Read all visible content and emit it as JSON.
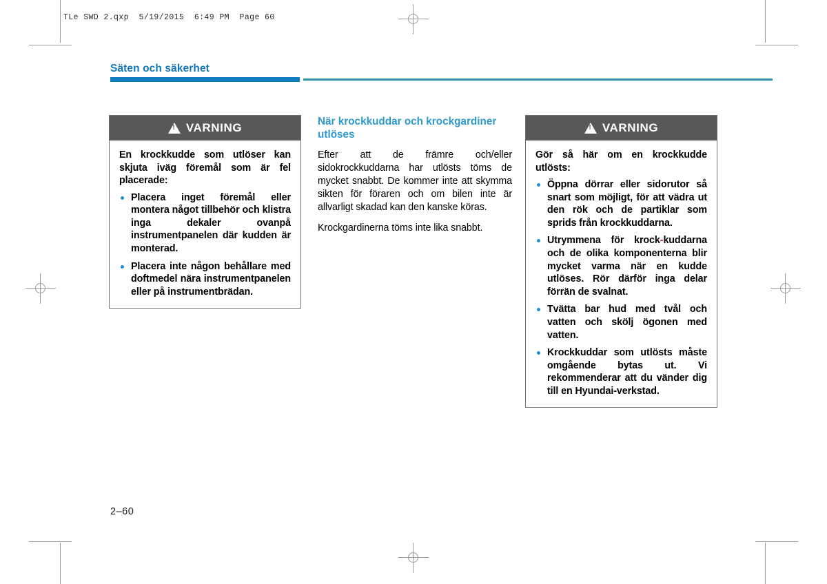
{
  "prepress": {
    "header_line": "TLe SWD 2.qxp  5/19/2015  6:49 PM  Page 60"
  },
  "page": {
    "section_title": "Säten och säkerhet",
    "page_number": "2–60",
    "accent_color": "#0f7fc0",
    "rule_thin_color": "#2b8fa8",
    "bullet_color": "#1e8fd0",
    "warning_header_bg": "#58585b",
    "subheading_color": "#2e9ad0",
    "red_hyphen_color": "#cf2027"
  },
  "left_warning": {
    "icon": "warning-triangle-icon",
    "label": "VARNING",
    "intro": "En krockkudde som utlöser kan skjuta iväg föremål som är fel placerade:",
    "bullets": [
      "Placera inget föremål eller montera något tillbehör och klistra inga dekaler ovanpå instrumentpanelen där kudden är monterad.",
      "Placera inte någon behållare med doftmedel nära instrumentpanelen eller på instrumentbrädan."
    ]
  },
  "middle_column": {
    "heading": "När krockkuddar och krockgardiner utlöses",
    "paragraphs": [
      "Efter att de främre och/eller sidokrockkuddarna har utlösts töms de mycket snabbt. De kommer inte att skymma sikten för föraren och om bilen inte är allvarligt skadad kan den kanske köras.",
      "Krockgardinerna töms inte lika snabbt."
    ]
  },
  "right_warning": {
    "icon": "warning-triangle-icon",
    "label": "VARNING",
    "intro": "Gör så här om en krockkudde utlösts:",
    "bullets": [
      {
        "text_before": "Öppna dörrar eller sidorutor så snart som möjligt, för att vädra ut den rök och de partiklar som sprids från krockkuddarna.",
        "hyphen": "",
        "text_after": ""
      },
      {
        "text_before": "Utrymmena för krock",
        "hyphen": "-",
        "text_after": "kuddarna och de olika komponenterna blir mycket varma när en kudde utlöses. Rör därför inga delar förrän de svalnat."
      },
      {
        "text_before": "Tvätta bar hud med tvål och vatten och skölj ögonen med vatten.",
        "hyphen": "",
        "text_after": ""
      },
      {
        "text_before": "Krockkuddar som utlösts måste omgående bytas ut. Vi rekommenderar att du vänder dig till en Hyundai-verkstad.",
        "hyphen": "",
        "text_after": ""
      }
    ]
  }
}
